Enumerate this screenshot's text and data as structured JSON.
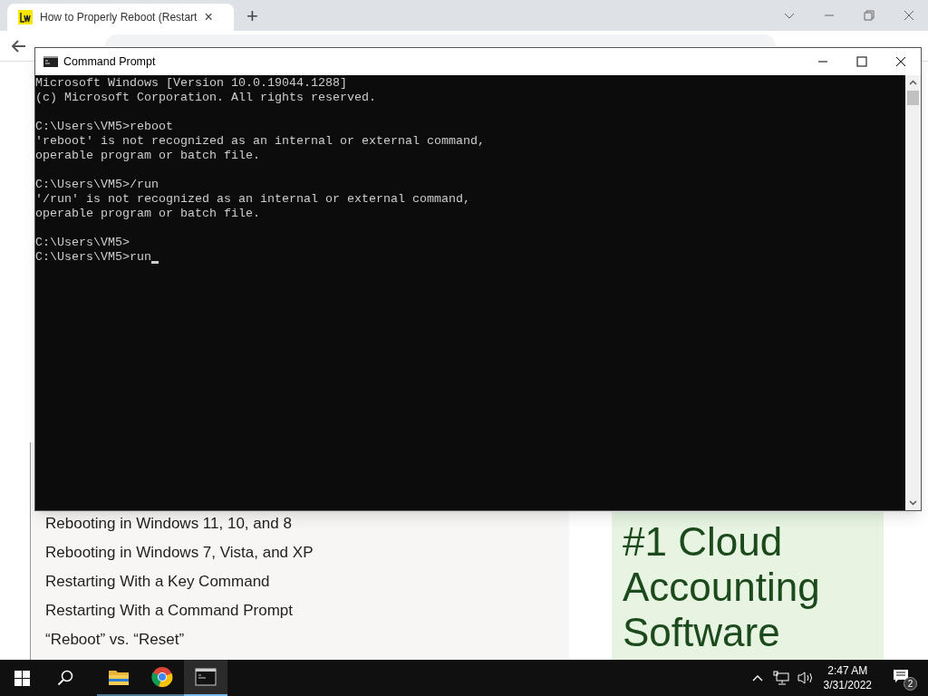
{
  "browser": {
    "tab": {
      "title": "How to Properly Reboot (Restart",
      "close": "×"
    },
    "new_tab": "+"
  },
  "page": {
    "toc": [
      "Rebooting in Windows 11, 10, and 8",
      "Rebooting in Windows 7, Vista, and XP",
      "Restarting With a Key Command",
      "Restarting With a Command Prompt",
      "“Reboot” vs. “Reset”"
    ],
    "ad": {
      "text": "#1 Cloud Accounting Software"
    }
  },
  "console_window": {
    "title": "Command Prompt",
    "blocks": [
      [
        "Microsoft Windows [Version 10.0.19044.1288]",
        "(c) Microsoft Corporation. All rights reserved."
      ],
      [
        "C:\\Users\\VM5>reboot",
        "'reboot' is not recognized as an internal or external command,",
        "operable program or batch file."
      ],
      [
        "C:\\Users\\VM5>/run",
        "'/run' is not recognized as an internal or external command,",
        "operable program or batch file."
      ],
      [
        "C:\\Users\\VM5>",
        "C:\\Users\\VM5>run"
      ]
    ],
    "cursor": true
  },
  "taskbar": {
    "apps": [
      {
        "kind": "files",
        "active": false
      },
      {
        "kind": "chrome",
        "active": false
      },
      {
        "kind": "console",
        "active": true
      }
    ],
    "time": "2:47 AM",
    "date": "3/31/2022",
    "notifications": "2"
  }
}
